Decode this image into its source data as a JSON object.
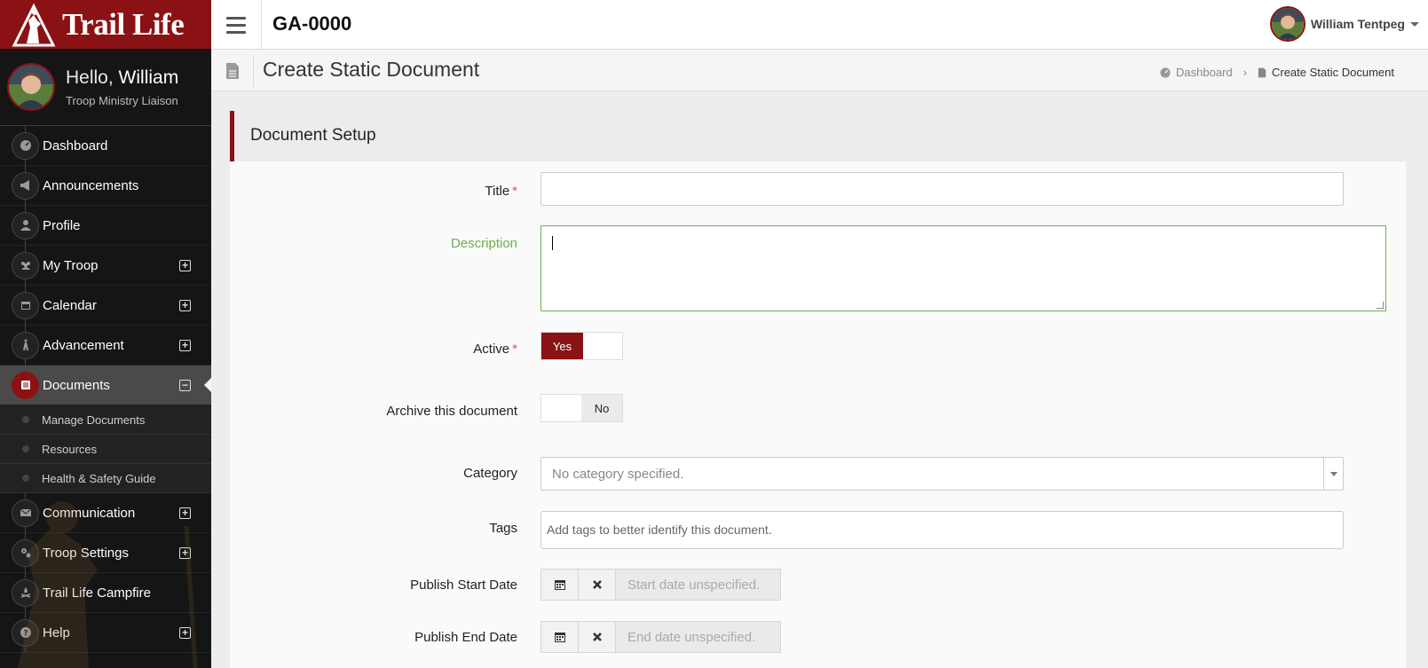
{
  "brand": {
    "name": "Trail Life",
    "color": "#8b1214"
  },
  "sidebar": {
    "greeting_prefix": "Hello,",
    "user_first_name": "William",
    "user_role": "Troop Ministry Liaison",
    "items": [
      {
        "label": "Dashboard",
        "icon": "dashboard-icon"
      },
      {
        "label": "Announcements",
        "icon": "megaphone-icon"
      },
      {
        "label": "Profile",
        "icon": "user-icon"
      },
      {
        "label": "My Troop",
        "icon": "group-icon",
        "expandable": true
      },
      {
        "label": "Calendar",
        "icon": "calendar-icon",
        "expandable": true
      },
      {
        "label": "Advancement",
        "icon": "hiker-icon",
        "expandable": true
      },
      {
        "label": "Documents",
        "icon": "document-list-icon",
        "expandable": true,
        "active": true,
        "children": [
          {
            "label": "Manage Documents"
          },
          {
            "label": "Resources"
          },
          {
            "label": "Health & Safety Guide"
          }
        ]
      },
      {
        "label": "Communication",
        "icon": "envelope-icon",
        "expandable": true
      },
      {
        "label": "Troop Settings",
        "icon": "gears-icon",
        "expandable": true
      },
      {
        "label": "Trail Life Campfire",
        "icon": "campfire-icon"
      },
      {
        "label": "Help",
        "icon": "question-icon",
        "expandable": true
      }
    ]
  },
  "topbar": {
    "troop_id": "GA-0000",
    "user_name": "William Tentpeg"
  },
  "page": {
    "title": "Create Static Document",
    "breadcrumb": [
      "Dashboard",
      "Create Static Document"
    ]
  },
  "form": {
    "section_title": "Document Setup",
    "title_label": "Title",
    "title_value": "",
    "description_label": "Description",
    "description_value": "",
    "active_label": "Active",
    "active_value": "Yes",
    "archive_label": "Archive this document",
    "archive_value": "No",
    "category_label": "Category",
    "category_placeholder": "No category specified.",
    "tags_label": "Tags",
    "tags_placeholder": "Add tags to better identify this document.",
    "start_label": "Publish Start Date",
    "start_placeholder": "Start date unspecified.",
    "end_label": "Publish End Date",
    "end_placeholder": "End date unspecified.",
    "required_marker": "*"
  },
  "colors": {
    "focus_green": "#6cb04a",
    "required_red": "#d9534f"
  }
}
